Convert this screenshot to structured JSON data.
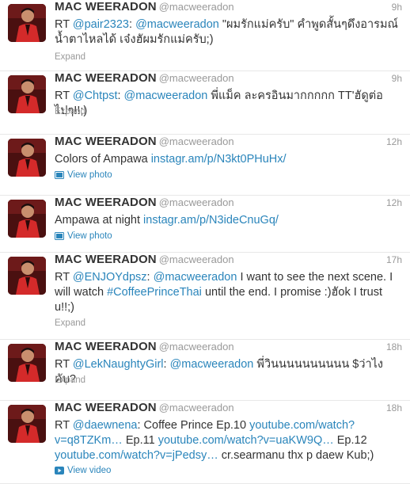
{
  "timeline": {
    "tweets": [
      {
        "name": "MAC WEERADON",
        "handle": "@macweeradon",
        "time": "9h",
        "segments": [
          {
            "t": "RT "
          },
          {
            "t": "@pair2323",
            "link": true
          },
          {
            "t": ": "
          },
          {
            "t": "@macweeradon",
            "link": true
          },
          {
            "t": " \"ผมรักแม่ครับ\" คำพูดสั้นๆดึงอารมณ์ น้ำตาไหลได้ เจ๋งฮัผมรักแม่ครับ;)"
          }
        ],
        "action": "Expand",
        "action_type": "expand"
      },
      {
        "name": "MAC WEERADON",
        "handle": "@macweeradon",
        "time": "9h",
        "segments": [
          {
            "t": "RT "
          },
          {
            "t": "@Chtpst",
            "link": true
          },
          {
            "t": ": "
          },
          {
            "t": "@macweeradon",
            "link": true
          },
          {
            "t": " พี่แม็ค ละครอินมากกกกก TT'ฮัดูต่อไปๆ!!;)"
          }
        ],
        "action": "Expand",
        "action_type": "expand"
      },
      {
        "name": "MAC WEERADON",
        "handle": "@macweeradon",
        "time": "12h",
        "segments": [
          {
            "t": "Colors of Ampawa "
          },
          {
            "t": "instagr.am/p/N3kt0PHuHx/",
            "link": true
          }
        ],
        "action": "View photo",
        "action_type": "photo"
      },
      {
        "name": "MAC WEERADON",
        "handle": "@macweeradon",
        "time": "12h",
        "segments": [
          {
            "t": "Ampawa at night "
          },
          {
            "t": "instagr.am/p/N3ideCnuGq/",
            "link": true
          }
        ],
        "action": "View photo",
        "action_type": "photo"
      },
      {
        "name": "MAC WEERADON",
        "handle": "@macweeradon",
        "time": "17h",
        "segments": [
          {
            "t": "RT "
          },
          {
            "t": "@ENJOYdpsz",
            "link": true
          },
          {
            "t": ": "
          },
          {
            "t": "@macweeradon",
            "link": true
          },
          {
            "t": " I want to see the next scene. I will watch "
          },
          {
            "t": "#CoffeePrinceThai",
            "link": true
          },
          {
            "t": " until the end. I promise :)ฮัok I trust u!!;)"
          }
        ],
        "action": "Expand",
        "action_type": "expand"
      },
      {
        "name": "MAC WEERADON",
        "handle": "@macweeradon",
        "time": "18h",
        "segments": [
          {
            "t": "RT "
          },
          {
            "t": "@LekNaughtyGirl",
            "link": true
          },
          {
            "t": ": "
          },
          {
            "t": "@macweeradon",
            "link": true
          },
          {
            "t": " พี่วินนนนนนนนนน $ว่าไงคับ?"
          }
        ],
        "action": "Expand",
        "action_type": "expand"
      },
      {
        "name": "MAC WEERADON",
        "handle": "@macweeradon",
        "time": "18h",
        "segments": [
          {
            "t": "RT "
          },
          {
            "t": "@daewnena",
            "link": true
          },
          {
            "t": ": Coffee Prince Ep.10 "
          },
          {
            "t": "youtube.com/watch?v=q8TZKm…",
            "link": true
          },
          {
            "t": " Ep.11 "
          },
          {
            "t": "youtube.com/watch?v=uaKW9Q…",
            "link": true
          },
          {
            "t": " Ep.12 "
          },
          {
            "t": "youtube.com/watch?v=jPedsy…",
            "link": true
          },
          {
            "t": " cr.searmanu thx p daew Kub;)"
          }
        ],
        "action": "View video",
        "action_type": "video"
      }
    ]
  },
  "colors": {
    "link": "#2a85bb",
    "meta": "#999999",
    "text": "#333333"
  }
}
